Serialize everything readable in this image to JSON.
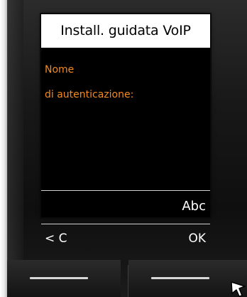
{
  "screen": {
    "title": "Install. guidata VoIP",
    "field_label_line1": "Nome",
    "field_label_line2": "di autenticazione:",
    "input_mode": "Abc",
    "softkey_left": "< C",
    "softkey_right": "OK"
  },
  "colors": {
    "label_orange": "#f28a1e",
    "screen_bg": "#000000",
    "title_bg": "#ffffff"
  },
  "icons": {
    "press_indicator": "arrow-pointer-icon"
  }
}
